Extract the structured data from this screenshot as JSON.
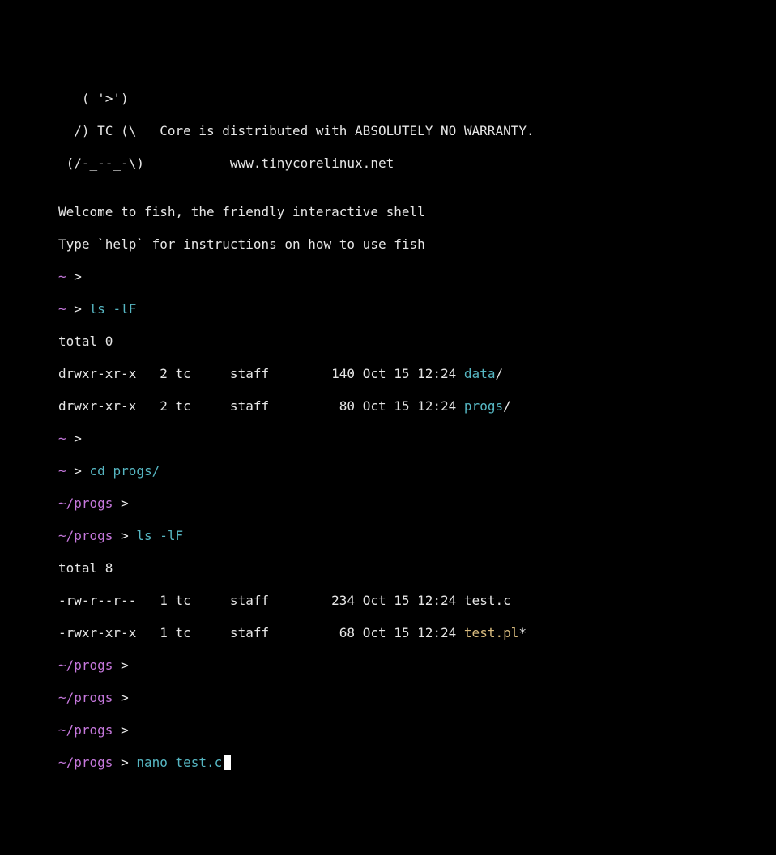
{
  "banner": {
    "line1": "   ( '>')",
    "line2": "  /) TC (\\   Core is distributed with ABSOLUTELY NO WARRANTY.",
    "line3": " (/-_--_-\\)           www.tinycorelinux.net",
    "line4": ""
  },
  "welcome": {
    "line1": "Welcome to fish, the friendly interactive shell",
    "line2": "Type `help` for instructions on how to use fish"
  },
  "prompts": {
    "home": "~",
    "progs": "~/progs",
    "sep": " > "
  },
  "commands": {
    "ls": "ls -lF",
    "cd": "cd progs/",
    "nano": "nano test.c"
  },
  "ls_home": {
    "total": "total 0",
    "row1": {
      "perms": "drwxr-xr-x",
      "links": "   2",
      "owner": " tc",
      "group": "     staff",
      "size": "        140",
      "date": " Oct 15 12:24 ",
      "name": "data",
      "suffix": "/"
    },
    "row2": {
      "perms": "drwxr-xr-x",
      "links": "   2",
      "owner": " tc",
      "group": "     staff",
      "size": "         80",
      "date": " Oct 15 12:24 ",
      "name": "progs",
      "suffix": "/"
    }
  },
  "ls_progs": {
    "total": "total 8",
    "row1": {
      "perms": "-rw-r--r--",
      "links": "   1",
      "owner": " tc",
      "group": "     staff",
      "size": "        234",
      "date": " Oct 15 12:24 ",
      "name": "test.c",
      "suffix": ""
    },
    "row2": {
      "perms": "-rwxr-xr-x",
      "links": "   1",
      "owner": " tc",
      "group": "     staff",
      "size": "         68",
      "date": " Oct 15 12:24 ",
      "name": "test.pl",
      "suffix": "*"
    }
  }
}
